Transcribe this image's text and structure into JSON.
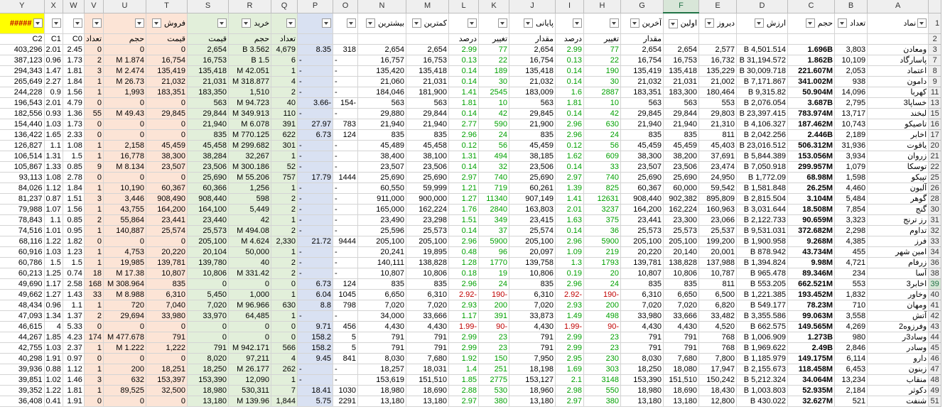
{
  "columns": [
    "Y",
    "X",
    "W",
    "V",
    "U",
    "T",
    "S",
    "R",
    "Q",
    "P",
    "O",
    "N",
    "M",
    "L",
    "K",
    "J",
    "I",
    "H",
    "G",
    "F",
    "E",
    "D",
    "C",
    "B",
    "A"
  ],
  "selected_column": "F",
  "groups": {
    "sell": "فروش",
    "buy": "خرید"
  },
  "headers": {
    "Y": "#####",
    "N": "بیشترین",
    "M": "کمترین",
    "J": "پایانی",
    "G": "آخرین",
    "F": "اولین",
    "E": "دیروز",
    "D": "ارزش",
    "C": "حجم",
    "B": "تعداد",
    "A": "نماد"
  },
  "subheaders": {
    "Y": "C2",
    "X": "C1",
    "W": "C0",
    "V": "تعداد",
    "U": "حجم",
    "T": "قیمت",
    "S": "قیمت",
    "R": "حجم",
    "Q": "تعداد",
    "L": "درصد",
    "K": "تغییر",
    "J": "مقدار",
    "I": "درصد",
    "H": "تغییر",
    "G": "مقدار"
  },
  "rows": [
    {
      "n": "3",
      "c": [
        "403,296",
        "2.01",
        "2.45",
        "0",
        "0",
        "0",
        "2,654",
        "B 3.562",
        "4,679",
        "8.35",
        "318",
        "2,654",
        "2,654",
        "2.99",
        "77",
        "2,654",
        "2.99",
        "77",
        "2,654",
        "2,654",
        "2,577",
        "B 4,501.514",
        "1.696B",
        "3,803",
        "ومعادن"
      ]
    },
    {
      "n": "7",
      "c": [
        "387,123",
        "0.96",
        "1.73",
        "2",
        "M 1.874",
        "16,754",
        "16,753",
        "B 1.5",
        "6",
        "-",
        "-",
        "16,757",
        "16,753",
        "0.13",
        "22",
        "16,754",
        "0.13",
        "22",
        "16,754",
        "16,753",
        "16,732",
        "B 31,194.572",
        "1.862B",
        "10,109",
        "پاسارگاد"
      ]
    },
    {
      "n": "8",
      "c": [
        "294,343",
        "1.47",
        "1.81",
        "3",
        "M 2.474",
        "135,419",
        "135,418",
        "M 42.051",
        "1",
        "-",
        "-",
        "135,420",
        "135,418",
        "0.14",
        "189",
        "135,418",
        "0.14",
        "190",
        "135,419",
        "135,418",
        "135,229",
        "B 30,009.718",
        "221.607M",
        "2,053",
        "اعتماد"
      ]
    },
    {
      "n": "9",
      "c": [
        "265,649",
        "2.27",
        "1.84",
        "1",
        "M 26.73",
        "21,032",
        "21,031",
        "M 318.877",
        "4",
        "-",
        "-",
        "21,060",
        "21,031",
        "0.14",
        "30",
        "21,032",
        "0.14",
        "30",
        "21,032",
        "21,031",
        "21,002",
        "B 7,171.867",
        "341.002M",
        "938",
        "دامون"
      ]
    },
    {
      "n": "11",
      "c": [
        "244,228",
        "0.9",
        "1.56",
        "1",
        "1,993",
        "183,351",
        "183,350",
        "1,510",
        "2",
        "-",
        "-",
        "184,046",
        "181,900",
        "1.41",
        "2545",
        "183,009",
        "1.6",
        "2887",
        "183,351",
        "183,300",
        "180,464",
        "B 9,315.82",
        "50.904M",
        "14,096",
        "کهربا"
      ]
    },
    {
      "n": "13",
      "c": [
        "196,543",
        "2.01",
        "4.79",
        "0",
        "0",
        "0",
        "563",
        "M 94.723",
        "40",
        "3.66-",
        "154-",
        "563",
        "563",
        "1.81",
        "10",
        "563",
        "1.81",
        "10",
        "563",
        "563",
        "553",
        "B 2,076.054",
        "3.687B",
        "2,795",
        "خساپا3"
      ]
    },
    {
      "n": "15",
      "c": [
        "182,556",
        "0.93",
        "1.36",
        "55",
        "M 49.43",
        "29,845",
        "29,844",
        "M 349.913",
        "110",
        "-",
        "-",
        "29,880",
        "29,844",
        "0.14",
        "42",
        "29,845",
        "0.14",
        "42",
        "29,845",
        "29,844",
        "29,803",
        "B 23,397.415",
        "783.974M",
        "13,717",
        "لبخند"
      ]
    },
    {
      "n": "16",
      "c": [
        "154,440",
        "1.03",
        "1.73",
        "0",
        "0",
        "0",
        "21,940",
        "M 6.078",
        "391",
        "27.97",
        "783",
        "21,940",
        "21,940",
        "2.77",
        "590",
        "21,900",
        "2.96",
        "630",
        "21,940",
        "21,940",
        "21,310",
        "B 4,106.327",
        "187.462M",
        "10,743",
        "تاصیکو"
      ]
    },
    {
      "n": "17",
      "c": [
        "136,422",
        "1.65",
        "2.33",
        "0",
        "0",
        "0",
        "835",
        "M 770.125",
        "622",
        "6.73",
        "124",
        "835",
        "835",
        "2.96",
        "24",
        "835",
        "2.96",
        "24",
        "835",
        "835",
        "811",
        "B 2,042.256",
        "2.446B",
        "2,189",
        "اخابر"
      ]
    },
    {
      "n": "20",
      "c": [
        "126,827",
        "1.1",
        "1.08",
        "1",
        "2,158",
        "45,459",
        "45,458",
        "M 299.682",
        "301",
        "-",
        "-",
        "45,489",
        "45,458",
        "0.12",
        "56",
        "45,459",
        "0.12",
        "56",
        "45,459",
        "45,459",
        "45,403",
        "B 23,016.512",
        "506.312M",
        "31,936",
        "یاقوت"
      ]
    },
    {
      "n": "21",
      "c": [
        "106,514",
        "1.31",
        "1.5",
        "1",
        "16,778",
        "38,300",
        "38,284",
        "32,267",
        "1",
        "-",
        "-",
        "38,400",
        "38,100",
        "1.31",
        "494",
        "38,185",
        "1.62",
        "609",
        "38,300",
        "38,200",
        "37,691",
        "B 5,844.389",
        "153.056M",
        "3,934",
        "زروان"
      ]
    },
    {
      "n": "22",
      "c": [
        "105,867",
        "1.33",
        "0.85",
        "9",
        "M 8.134",
        "23,507",
        "23,506",
        "M 300.186",
        "52",
        "-",
        "-",
        "23,507",
        "23,506",
        "0.14",
        "32",
        "23,506",
        "0.14",
        "33",
        "23,507",
        "23,506",
        "23,474",
        "B 7,050.918",
        "299.957M",
        "1,079",
        "توسکا"
      ]
    },
    {
      "n": "25",
      "c": [
        "93,113",
        "1.08",
        "2.78",
        "0",
        "0",
        "0",
        "25,690",
        "M 55.206",
        "757",
        "17.79",
        "1444",
        "25,690",
        "25,690",
        "2.97",
        "740",
        "25,690",
        "2.97",
        "740",
        "25,690",
        "25,690",
        "24,950",
        "B 1,772.09",
        "68.98M",
        "1,598",
        "تپیکو"
      ]
    },
    {
      "n": "26",
      "c": [
        "84,026",
        "1.12",
        "1.84",
        "1",
        "10,190",
        "60,367",
        "60,366",
        "1,256",
        "1",
        "-",
        "-",
        "60,550",
        "59,999",
        "1.21",
        "719",
        "60,261",
        "1.39",
        "825",
        "60,367",
        "60,000",
        "59,542",
        "B 1,581.848",
        "26.25M",
        "4,460",
        "آلبون"
      ]
    },
    {
      "n": "28",
      "c": [
        "81,237",
        "0.87",
        "1.51",
        "3",
        "3,446",
        "908,490",
        "908,440",
        "598",
        "2",
        "-",
        "-",
        "911,000",
        "900,000",
        "1.27",
        "11340",
        "907,149",
        "1.41",
        "12631",
        "908,440",
        "902,382",
        "895,809",
        "B 2,815.504",
        "3.104M",
        "5,484",
        "گوهر"
      ]
    },
    {
      "n": "30",
      "c": [
        "79,988",
        "1.07",
        "1.56",
        "1",
        "43,755",
        "164,200",
        "164,100",
        "5,449",
        "2",
        "-",
        "-",
        "165,000",
        "162,224",
        "1.76",
        "2840",
        "163,803",
        "2.01",
        "3237",
        "164,200",
        "162,224",
        "160,963",
        "B 3,031.644",
        "18.508M",
        "7,854",
        "گنج"
      ]
    },
    {
      "n": "31",
      "c": [
        "78,843",
        "1.1",
        "0.85",
        "2",
        "55,864",
        "23,441",
        "23,440",
        "42",
        "1",
        "-",
        "-",
        "23,490",
        "23,298",
        "1.51",
        "349",
        "23,415",
        "1.63",
        "375",
        "23,441",
        "23,300",
        "23,066",
        "B 2,122.733",
        "90.659M",
        "3,323",
        "رز ترنج"
      ]
    },
    {
      "n": "32",
      "c": [
        "74,516",
        "1.01",
        "0.95",
        "1",
        "140,887",
        "25,574",
        "25,573",
        "M 494.08",
        "2",
        "-",
        "-",
        "25,596",
        "25,573",
        "0.14",
        "37",
        "25,574",
        "0.14",
        "36",
        "25,573",
        "25,573",
        "25,537",
        "B 9,531.031",
        "372.682M",
        "2,298",
        "تداوم"
      ]
    },
    {
      "n": "33",
      "c": [
        "68,116",
        "1.22",
        "1.82",
        "0",
        "0",
        "0",
        "205,100",
        "M 4.624",
        "2,330",
        "21.72",
        "9444",
        "205,100",
        "205,100",
        "2.96",
        "5900",
        "205,100",
        "2.96",
        "5900",
        "205,100",
        "205,100",
        "199,200",
        "B 1,900.958",
        "9.268M",
        "4,385",
        "فرز"
      ]
    },
    {
      "n": "34",
      "c": [
        "60,916",
        "1.03",
        "1.23",
        "1",
        "4,753",
        "20,220",
        "20,104",
        "50,000",
        "1",
        "-",
        "-",
        "20,241",
        "19,895",
        "0.48",
        "96",
        "20,097",
        "1.09",
        "219",
        "20,220",
        "20,140",
        "20,001",
        "B 878.942",
        "43.734M",
        "455",
        "امین شهر"
      ]
    },
    {
      "n": "36",
      "c": [
        "60,786",
        "1.5",
        "1.5",
        "1",
        "19,985",
        "139,781",
        "139,780",
        "40",
        "2",
        "-",
        "-",
        "140,111",
        "138,828",
        "1.28",
        "1770",
        "139,758",
        "1.3",
        "1793",
        "139,781",
        "138,828",
        "137,988",
        "B 1,394.824",
        "9.98M",
        "4,721",
        "زرفام"
      ]
    },
    {
      "n": "38",
      "c": [
        "60,213",
        "1.25",
        "0.74",
        "18",
        "M 17.38",
        "10,807",
        "10,806",
        "M 331.42",
        "2",
        "-",
        "-",
        "10,807",
        "10,806",
        "0.18",
        "19",
        "10,806",
        "0.19",
        "20",
        "10,807",
        "10,806",
        "10,787",
        "B 965.478",
        "89.346M",
        "234",
        "آسا"
      ]
    },
    {
      "n": "39",
      "c": [
        "49,690",
        "1.17",
        "2.58",
        "168",
        "M 308.964",
        "835",
        "0",
        "0",
        "0",
        "6.73",
        "124",
        "835",
        "835",
        "2.96",
        "24",
        "835",
        "2.96",
        "24",
        "835",
        "835",
        "811",
        "B 553.205",
        "662.521M",
        "553",
        "اخابر3"
      ]
    },
    {
      "n": "40",
      "c": [
        "49,662",
        "1.27",
        "1.43",
        "33",
        "M 8.988",
        "6,310",
        "5,450",
        "1,000",
        "1",
        "6.04",
        "1045",
        "6,650",
        "6,310",
        "2.92-",
        "190-",
        "6,310",
        "2.92-",
        "190-",
        "6,310",
        "6,650",
        "6,500",
        "B 1,221.385",
        "193.452M",
        "1,832",
        "وخاور"
      ]
    },
    {
      "n": "41",
      "c": [
        "48,434",
        "0.96",
        "1.1",
        "1",
        "720",
        "7,040",
        "7,020",
        "M 96.966",
        "630",
        "8.8",
        "798",
        "7,020",
        "7,020",
        "2.93",
        "200",
        "7,020",
        "2.93",
        "200",
        "7,020",
        "7,020",
        "6,820",
        "B 549.177",
        "78.23M",
        "710",
        "ومهان"
      ]
    },
    {
      "n": "42",
      "c": [
        "47,093",
        "1.34",
        "1.37",
        "2",
        "29,694",
        "33,980",
        "33,970",
        "64,485",
        "1",
        "-",
        "-",
        "34,000",
        "33,666",
        "1.17",
        "391",
        "33,873",
        "1.49",
        "498",
        "33,980",
        "33,666",
        "33,482",
        "B 3,355.586",
        "99.063M",
        "3,558",
        "آتش"
      ]
    },
    {
      "n": "43",
      "c": [
        "46,615",
        "4",
        "5.33",
        "0",
        "0",
        "0",
        "0",
        "0",
        "0",
        "9.71",
        "456",
        "4,430",
        "4,430",
        "1.99-",
        "90-",
        "4,430",
        "1.99-",
        "90-",
        "4,430",
        "4,430",
        "4,520",
        "B 662.575",
        "149.565M",
        "4,269",
        "وفرزوه2"
      ]
    },
    {
      "n": "44",
      "c": [
        "44,267",
        "1.85",
        "4.23",
        "174",
        "M 477.678",
        "791",
        "0",
        "0",
        "0",
        "158.2",
        "5",
        "791",
        "791",
        "2.99",
        "23",
        "791",
        "2.99",
        "23",
        "791",
        "791",
        "768",
        "B 1,006.909",
        "1.273B",
        "980",
        "وساد3ر"
      ]
    },
    {
      "n": "45",
      "c": [
        "42,755",
        "1.03",
        "2.37",
        "1",
        "M 1.222",
        "1,222",
        "791",
        "M 942.171",
        "566",
        "158.2",
        "5",
        "791",
        "791",
        "2.99",
        "23",
        "791",
        "2.99",
        "23",
        "791",
        "791",
        "768",
        "B 1,969.622",
        "2.49B",
        "2,846",
        "وسادر"
      ]
    },
    {
      "n": "46",
      "c": [
        "40,298",
        "1.91",
        "0.97",
        "0",
        "0",
        "0",
        "8,020",
        "97,211",
        "4",
        "9.45",
        "841",
        "8,030",
        "7,680",
        "1.92",
        "150",
        "7,950",
        "2.95",
        "230",
        "8,030",
        "7,680",
        "7,800",
        "B 1,185.979",
        "149.175M",
        "6,114",
        "دارو"
      ]
    },
    {
      "n": "47",
      "c": [
        "39,936",
        "0.88",
        "1.12",
        "1",
        "200",
        "18,251",
        "18,250",
        "M 26.177",
        "262",
        "-",
        "-",
        "18,257",
        "18,031",
        "1.4",
        "251",
        "18,198",
        "1.69",
        "303",
        "18,250",
        "18,080",
        "17,947",
        "B 2,155.673",
        "118.458M",
        "6,453",
        "زبنون"
      ]
    },
    {
      "n": "48",
      "c": [
        "39,851",
        "1.02",
        "1.46",
        "3",
        "632",
        "153,397",
        "153,390",
        "12,090",
        "1",
        "-",
        "-",
        "153,619",
        "151,510",
        "1.85",
        "2775",
        "153,127",
        "2.1",
        "3148",
        "153,390",
        "151,510",
        "150,242",
        "B 5,212.324",
        "34.064M",
        "13,234",
        "منقاب"
      ]
    },
    {
      "n": "49",
      "c": [
        "39,352",
        "1.22",
        "1.81",
        "1",
        "89,525",
        "32,500",
        "18,980",
        "530,311",
        "7",
        "18.41",
        "1030",
        "18,980",
        "18,690",
        "2.88",
        "530",
        "18,960",
        "2.98",
        "550",
        "18,980",
        "18,690",
        "18,430",
        "B 1,003.803",
        "52.935M",
        "2,184",
        "دکوثر"
      ]
    },
    {
      "n": "51",
      "c": [
        "36,408",
        "0.41",
        "1.91",
        "0",
        "0",
        "0",
        "13,180",
        "M 139.96",
        "1,844",
        "5.75",
        "2291",
        "13,180",
        "13,180",
        "2.97",
        "380",
        "13,180",
        "2.97",
        "380",
        "13,180",
        "13,180",
        "12,800",
        "B 430.022",
        "32.627M",
        "521",
        "شنفت"
      ]
    }
  ]
}
